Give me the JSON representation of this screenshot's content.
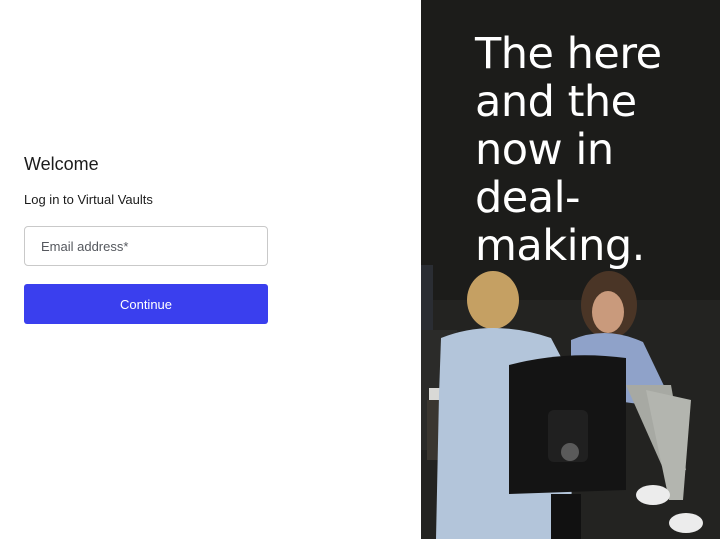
{
  "login": {
    "welcome": "Welcome",
    "subtitle": "Log in to Virtual Vaults",
    "email_placeholder": "Email address*",
    "email_value": "",
    "continue_label": "Continue"
  },
  "hero": {
    "headline_lines": [
      "The here",
      "and the",
      "now in",
      "deal-",
      "making."
    ]
  },
  "colors": {
    "primary_button": "#3a3fee",
    "hero_background": "#1e1e1c",
    "hero_text": "#ffffff"
  }
}
